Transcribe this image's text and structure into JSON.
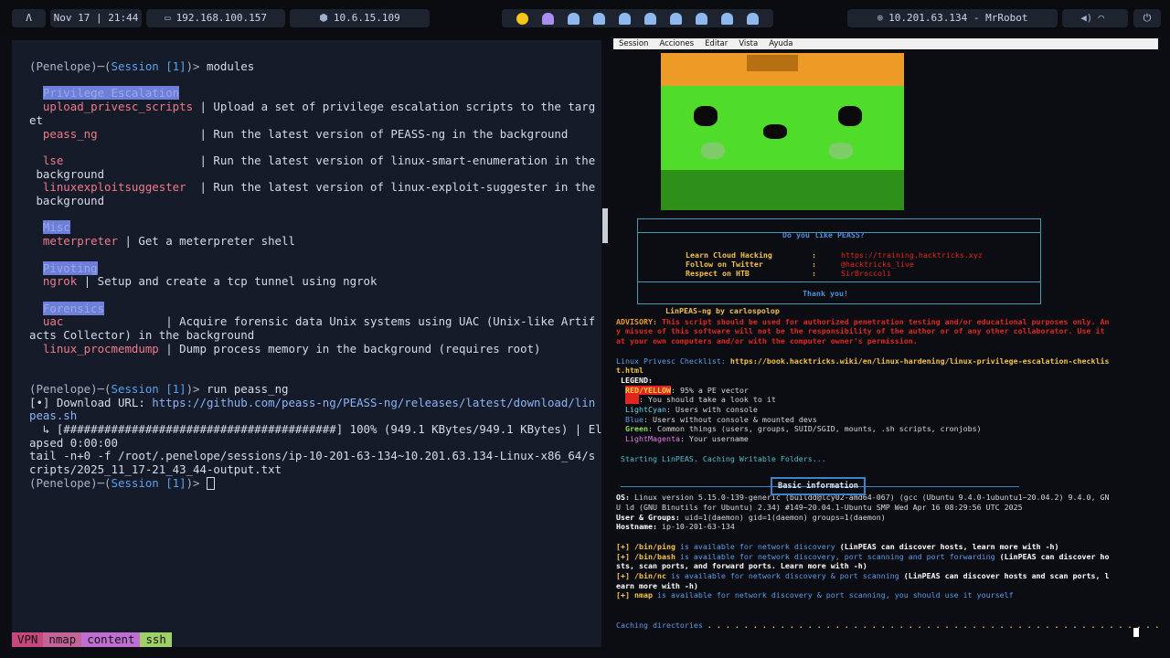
{
  "topbar": {
    "logo_glyph": "Λ",
    "datetime": "Nov 17 | 21:44",
    "ip_local": "192.168.100.157",
    "ip_vpn": "10.6.15.109",
    "target": "10.201.63.134 - MrRobot",
    "icons": [
      "monitor-icon",
      "cube-icon",
      "target-icon",
      "volume-icon",
      "wifi-icon",
      "power-icon"
    ]
  },
  "left_terminal": {
    "prompt_user": "(Penelope)─(",
    "session": "Session [1]",
    "prompt_end": ")> ",
    "cmd1": "modules",
    "cat_privesc": "Privilege Escalation",
    "mod_upload": "upload_privesc_scripts",
    "desc_upload_1": " | Upload a set of privilege escalation scripts to the targ",
    "desc_upload_2": "et",
    "mod_peass": "peass_ng",
    "desc_peass": "               | Run the latest version of PEASS-ng in the background",
    "mod_lse": "lse",
    "desc_lse_1": "                    | Run the latest version of linux-smart-enumeration in the",
    "desc_lse_2": " background",
    "mod_les": "linuxexploitsuggester",
    "desc_les_1": "  | Run the latest version of linux-exploit-suggester in the",
    "desc_les_2": " background",
    "cat_misc": "Misc",
    "mod_meterpreter": "meterpreter",
    "desc_meterpreter": " | Get a meterpreter shell",
    "cat_pivoting": "Pivoting",
    "mod_ngrok": "ngrok",
    "desc_ngrok": " | Setup and create a tcp tunnel using ngrok",
    "cat_forensics": "Forensics",
    "mod_uac": "uac",
    "desc_uac_1": "               | Acquire forensic data Unix systems using UAC (Unix-like Artif",
    "desc_uac_2": "acts Collector) in the background",
    "mod_procmem": "linux_procmemdump",
    "desc_procmem": " | Dump process memory in the background (requires root)",
    "cmd2": "run peass_ng",
    "download_prefix": "[•] Download URL: ",
    "download_url_1": "https://github.com/peass-ng/PEASS-ng/releases/latest/download/lin",
    "download_url_2": "peas.sh",
    "progress_1": "  ↳ [########################################] 100% (949.1 KBytes/949.1 KBytes) | El",
    "progress_2": "apsed 0:00:00",
    "tail_1": "tail -n+0 -f /root/.penelope/sessions/ip-10-201-63-134~10.201.63.134-Linux-x86_64/s",
    "tail_2": "cripts/2025_11_17-21_43_44-output.txt"
  },
  "statusbar": [
    "VPN",
    "nmap",
    "content",
    "ssh"
  ],
  "right_menu": [
    "Session",
    "Acciones",
    "Editar",
    "Vista",
    "Ayuda"
  ],
  "peass_box": {
    "question": "Do you like PEASS?",
    "learn_label": "Learn Cloud Hacking",
    "learn_value": "https://training.hacktricks.xyz",
    "twitter_label": "Follow on Twitter",
    "twitter_value": "@hacktricks_live",
    "respect_label": "Respect on HTB",
    "respect_value": "SirBroccoli",
    "thanks": "Thank you!",
    "author": "LinPEAS-ng by carlospolop",
    "colon": ":"
  },
  "right_output": {
    "advisory_label": "ADVISORY: ",
    "advisory_1": "This script should be used for authorized penetration testing and/or educational purposes only. An",
    "advisory_2": "y misuse of this software will not be the responsibility of the author or of any other collaborator. Use it",
    "advisory_3": "at your own computers and/or with the computer owner's permission.",
    "checklist_label": "Linux Privesc Checklist: ",
    "checklist_url_1": "https://book.hacktricks.wiki/en/linux-hardening/linux-privilege-escalation-checklis",
    "checklist_url_2": "t.html",
    "legend": " LEGEND:",
    "leg_redyellow": "RED/YELLOW",
    "leg_redyellow_desc": ": 95% a PE vector",
    "leg_red": "RED",
    "leg_red_desc": ": You should take a look to it",
    "leg_cyan": "LightCyan",
    "leg_cyan_desc": ": Users with console",
    "leg_blue": "Blue",
    "leg_blue_desc": ": Users without console & mounted devs",
    "leg_green": "Green",
    "leg_green_desc": ": Common things (users, groups, SUID/SGID, mounts, .sh scripts, cronjobs)",
    "leg_mag": "LightMagenta",
    "leg_mag_desc": ": Your username",
    "starting": " Starting LinPEAS. Caching Writable Folders...",
    "basic_info": "Basic information",
    "os_label": "OS: ",
    "os_1": "Linux version 5.15.0-139-generic (buildd@lcy02-amd64-067) (gcc (Ubuntu 9.4.0-1ubuntu1~20.04.2) 9.4.0, GN",
    "os_2": "U ld (GNU Binutils for Ubuntu) 2.34) #149~20.04.1-Ubuntu SMP Wed Apr 16 08:29:56 UTC 2025",
    "ug_label": "User & Groups: ",
    "ug_value": "uid=1(daemon) gid=1(daemon) groups=1(daemon)",
    "host_label": "Hostname: ",
    "host_value": "ip-10-201-63-134",
    "plus": "[+] ",
    "ping_bin": "/bin/ping",
    "ping_mid": " is available for network discovery ",
    "ping_end": "(LinPEAS can discover hosts, learn more with -h)",
    "bash_bin": "/bin/bash",
    "bash_mid": " is available for network discovery, port scanning and port forwarding ",
    "bash_end_1": "(LinPEAS can discover ho",
    "bash_end_2": "sts, scan ports, and forward ports. Learn more with -h)",
    "nc_bin": "/bin/nc",
    "nc_mid": " is available for network discovery & port scanning ",
    "nc_end_1": "(LinPEAS can discover hosts and scan ports, l",
    "nc_end_2": "earn more with -h)",
    "nmap_bin": "nmap",
    "nmap_mid": " is available for network discovery & port scanning, you should use it yourself",
    "caching_label": "Caching directories ",
    "caching_dots": ". . . . . . . . . . . . . . . . . . . . . . . . . . . . . . . . . . . . . . . . . . . . . . . . . . . . ."
  }
}
